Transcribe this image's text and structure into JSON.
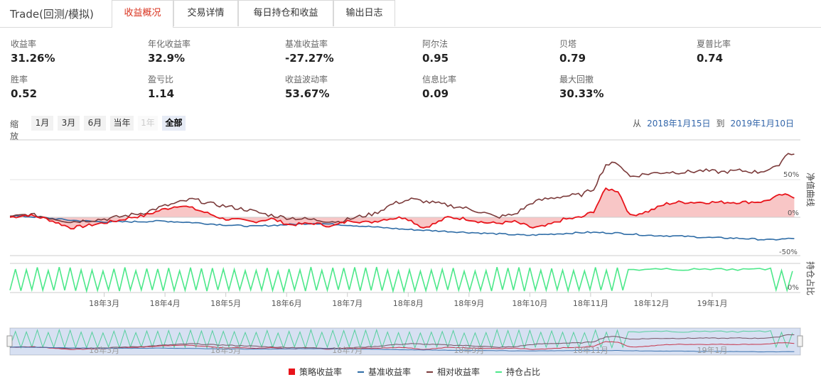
{
  "app_title": "Trade(回测/模拟)",
  "tabs": [
    {
      "label": "收益概况",
      "active": true
    },
    {
      "label": "交易详情",
      "active": false
    },
    {
      "label": "每日持仓和收益",
      "active": false
    },
    {
      "label": "输出日志",
      "active": false
    }
  ],
  "stats": [
    {
      "label": "收益率",
      "value": "31.26%"
    },
    {
      "label": "年化收益率",
      "value": "32.9%"
    },
    {
      "label": "基准收益率",
      "value": "-27.27%"
    },
    {
      "label": "阿尔法",
      "value": "0.95"
    },
    {
      "label": "贝塔",
      "value": "0.79"
    },
    {
      "label": "夏普比率",
      "value": "0.74"
    },
    {
      "label": "胜率",
      "value": "0.52"
    },
    {
      "label": "盈亏比",
      "value": "1.14"
    },
    {
      "label": "收益波动率",
      "value": "53.67%"
    },
    {
      "label": "信息比率",
      "value": "0.09"
    },
    {
      "label": "最大回撤",
      "value": "30.33%"
    }
  ],
  "zoom": {
    "label": "缩放",
    "buttons": [
      {
        "label": "1月",
        "state": "normal"
      },
      {
        "label": "3月",
        "state": "normal"
      },
      {
        "label": "6月",
        "state": "normal"
      },
      {
        "label": "当年",
        "state": "normal"
      },
      {
        "label": "1年",
        "state": "disabled"
      },
      {
        "label": "全部",
        "state": "active"
      }
    ]
  },
  "range": {
    "from_label": "从",
    "from": "2018年1月15日",
    "to_label": "到",
    "to": "2019年1月10日"
  },
  "colors": {
    "strategy": "#e8141b",
    "benchmark": "#2e6ca6",
    "relative": "#7b3a3a",
    "position": "#4de88a",
    "accent": "#d9321e"
  },
  "chart_data": {
    "type": "line",
    "x_ticks": [
      "18年3月",
      "18年4月",
      "18年5月",
      "18年6月",
      "18年7月",
      "18年8月",
      "18年9月",
      "18年10月",
      "18年11月",
      "18年12月",
      "19年1月"
    ],
    "panes": [
      {
        "title": "净值曲线",
        "y_ticks": [
          "50%",
          "0%",
          "-50%"
        ],
        "ylim": [
          -52,
          85
        ]
      },
      {
        "title": "持仓占比",
        "y_ticks": [
          "0%"
        ],
        "ylim": [
          0,
          100
        ]
      }
    ],
    "series": [
      {
        "name": "策略收益率",
        "color": "#e8141b",
        "x_months": [
          0,
          0.3,
          0.6,
          1.0,
          1.2,
          1.5,
          1.8,
          2.0,
          2.2,
          2.5,
          2.8,
          3.0,
          3.3,
          3.5,
          3.8,
          4.0,
          4.3,
          4.6,
          5.0,
          5.3,
          5.6,
          5.9,
          6.2,
          6.5,
          6.8,
          7.0,
          7.2,
          7.5,
          7.8,
          8.0,
          8.3,
          8.6,
          8.8,
          9.1,
          9.4,
          9.6,
          9.8,
          10.0,
          10.2,
          10.5,
          10.8,
          11.0,
          11.3,
          11.6,
          11.8,
          12.1,
          12.4,
          12.7,
          12.9
        ],
        "values": [
          0,
          3,
          -2,
          -14,
          -12,
          -8,
          -4,
          0,
          2,
          10,
          16,
          12,
          4,
          -2,
          -4,
          -6,
          -2,
          -10,
          -8,
          -12,
          -4,
          -7,
          -2,
          0,
          -14,
          -8,
          0,
          -2,
          -7,
          -8,
          -6,
          -14,
          -12,
          -3,
          0,
          8,
          38,
          35,
          2,
          8,
          18,
          20,
          20,
          20,
          20,
          20,
          21,
          30,
          27
        ]
      },
      {
        "name": "基准收益率",
        "color": "#2e6ca6",
        "x_months": [
          0,
          0.5,
          1.0,
          1.5,
          2.0,
          2.5,
          3.0,
          3.5,
          4.0,
          4.5,
          5.0,
          5.5,
          6.0,
          6.5,
          7.0,
          7.5,
          8.0,
          8.5,
          9.0,
          9.5,
          10.0,
          10.5,
          11.0,
          11.5,
          12.0,
          12.5,
          12.9
        ],
        "values": [
          2,
          0,
          -4,
          -6,
          -6,
          -5,
          -7,
          -10,
          -12,
          -10,
          -8,
          -10,
          -13,
          -16,
          -18,
          -20,
          -22,
          -24,
          -22,
          -20,
          -21,
          -24,
          -25,
          -27,
          -28,
          -30,
          -28
        ]
      },
      {
        "name": "相对收益率",
        "color": "#7b3a3a",
        "x_months": [
          0,
          0.3,
          0.6,
          1.0,
          1.3,
          1.6,
          1.9,
          2.2,
          2.5,
          2.8,
          3.0,
          3.3,
          3.6,
          3.9,
          4.2,
          4.5,
          4.8,
          5.1,
          5.4,
          5.7,
          6.0,
          6.3,
          6.6,
          6.9,
          7.2,
          7.5,
          7.8,
          8.0,
          8.3,
          8.6,
          8.8,
          9.1,
          9.4,
          9.6,
          9.8,
          10.0,
          10.2,
          10.5,
          10.8,
          11.1,
          11.4,
          11.7,
          12.0,
          12.3,
          12.6,
          12.8,
          12.9
        ],
        "values": [
          0,
          4,
          0,
          -6,
          -4,
          -2,
          2,
          6,
          14,
          20,
          24,
          18,
          14,
          10,
          4,
          0,
          -2,
          -4,
          -6,
          0,
          5,
          18,
          24,
          20,
          16,
          12,
          6,
          0,
          4,
          20,
          24,
          28,
          30,
          38,
          70,
          72,
          54,
          58,
          60,
          60,
          62,
          60,
          62,
          60,
          66,
          86,
          84
        ]
      },
      {
        "name": "持仓占比",
        "color": "#4de88a",
        "pane": 2
      }
    ]
  },
  "legend": [
    {
      "label": "策略收益率",
      "color": "#e8141b",
      "shape": "square"
    },
    {
      "label": "基准收益率",
      "color": "#2e6ca6",
      "shape": "line"
    },
    {
      "label": "相对收益率",
      "color": "#7b3a3a",
      "shape": "line"
    },
    {
      "label": "持仓占比",
      "color": "#4de88a",
      "shape": "line"
    }
  ]
}
